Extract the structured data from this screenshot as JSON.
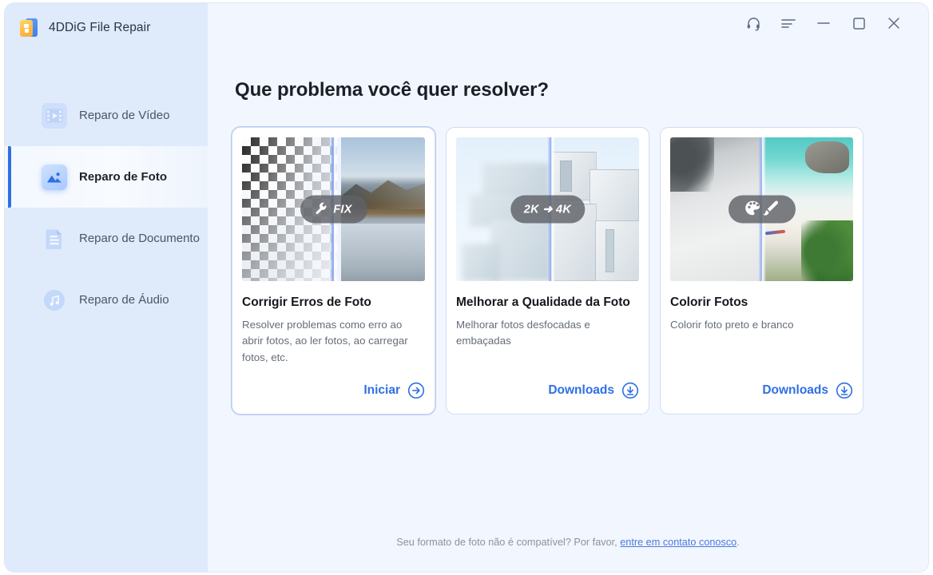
{
  "app": {
    "title": "4DDiG File Repair",
    "logo_icon": "4ddig-logo-icon"
  },
  "titlebar": {
    "buttons": [
      {
        "name": "support-headset-icon",
        "label": ""
      },
      {
        "name": "menu-icon",
        "label": ""
      },
      {
        "name": "minimize-icon",
        "label": ""
      },
      {
        "name": "maximize-icon",
        "label": ""
      },
      {
        "name": "close-icon",
        "label": ""
      }
    ]
  },
  "sidebar": {
    "items": [
      {
        "label": "Reparo de Vídeo",
        "icon": "video-icon",
        "active": false
      },
      {
        "label": "Reparo de Foto",
        "icon": "photo-icon",
        "active": true
      },
      {
        "label": "Reparo de Documento",
        "icon": "document-icon",
        "active": false
      },
      {
        "label": "Reparo de Áudio",
        "icon": "audio-icon",
        "active": false
      }
    ]
  },
  "main": {
    "heading": "Que problema você quer resolver?",
    "cards": [
      {
        "title": "Corrigir Erros de Foto",
        "description": "Resolver problemas como erro ao abrir fotos, ao ler fotos, ao carregar fotos, etc.",
        "action_label": "Iniciar",
        "action_icon": "arrow-right-circle-icon",
        "badge_text": "FIX",
        "badge_icon": "wrench-icon",
        "thumb_alt": "foto corrompida quadriculada ao lado de foto de lago e montanha"
      },
      {
        "title": "Melhorar a Qualidade da Foto",
        "description": "Melhorar fotos desfocadas e embaçadas",
        "action_label": "Downloads",
        "action_icon": "download-circle-icon",
        "badge_text": "2K ➜ 4K",
        "badge_icon": "",
        "thumb_alt": "prédio desfocado ao lado de prédio nítido"
      },
      {
        "title": "Colorir Fotos",
        "description": "Colorir foto preto e branco",
        "action_label": "Downloads",
        "action_icon": "download-circle-icon",
        "badge_text": "",
        "badge_icon": "palette-brush-icon",
        "thumb_alt": "praia em preto e branco ao lado de praia colorida"
      }
    ]
  },
  "footer": {
    "text_before": "Seu formato de foto não é compatível? Por favor, ",
    "link_text": "entre em contato conosco",
    "text_after": "."
  },
  "colors": {
    "accent": "#2f6fe4",
    "sidebar_bg": "#dfeafb",
    "main_bg": "#f2f6fe",
    "card_border": "#cfdcf6"
  }
}
